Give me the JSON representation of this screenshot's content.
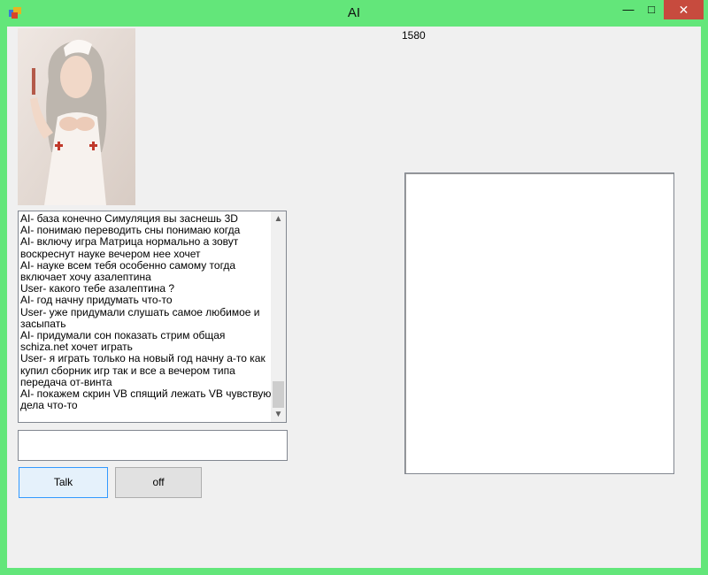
{
  "window": {
    "title": "AI"
  },
  "counter": "1580",
  "chat": {
    "lines": [
      "AI- база конечно Симуляция вы заснешь 3D",
      "AI- понимаю переводить сны понимаю когда",
      "AI- включу игра Матрица нормально а зовут воскреснут науке вечером нее хочет",
      "AI- науке всем тебя особенно самому тогда включает хочу азалептина",
      "User- какого тебе азалептина ?",
      "AI- год начну придумать что-то",
      "User- уже придумали слушать самое любимое и засыпать",
      "AI- придумали сон показать  стрим общая schiza.net хочет играть",
      "User- я играть только на новый год начну а-то как купил сборник игр так и все а вечером типа передача от-винта",
      "AI- покажем скрин VB спящий лежать VB чувствую дела что-то"
    ]
  },
  "buttons": {
    "talk": "Talk",
    "off": "off"
  },
  "colors": {
    "frame": "#63e67a",
    "close": "#c74b3e",
    "client": "#f0f0f0",
    "focus_border": "#3399ff"
  },
  "icons": {
    "app": "app-window-icon",
    "minimize": "minimize-icon",
    "maximize": "maximize-icon",
    "close": "close-icon",
    "scroll_up": "chevron-up-icon",
    "scroll_down": "chevron-down-icon"
  }
}
